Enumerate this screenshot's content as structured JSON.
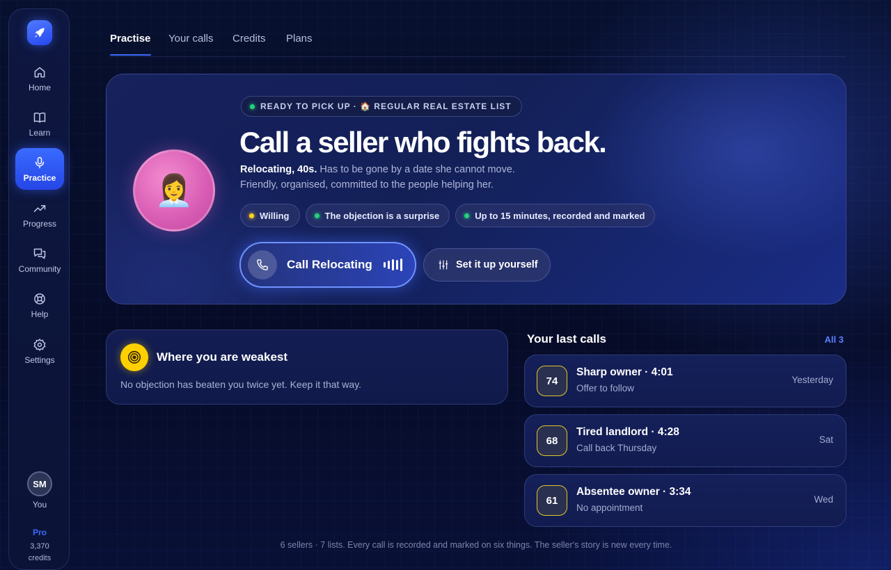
{
  "sidebar": {
    "items": [
      {
        "label": "Home",
        "icon": "home-icon"
      },
      {
        "label": "Learn",
        "icon": "book-icon"
      },
      {
        "label": "Practice",
        "icon": "microphone-icon",
        "active": true
      },
      {
        "label": "Progress",
        "icon": "trending-up-icon"
      },
      {
        "label": "Community",
        "icon": "chat-bubbles-icon"
      },
      {
        "label": "Help",
        "icon": "lifebuoy-icon"
      },
      {
        "label": "Settings",
        "icon": "gear-icon"
      }
    ],
    "user": {
      "initials": "SM",
      "label": "You"
    },
    "plan": "Pro",
    "credits": "3,370",
    "credits_label": "credits"
  },
  "tabs": [
    "Practise",
    "Your calls",
    "Credits",
    "Plans"
  ],
  "hero": {
    "status": "READY TO PICK UP · 🏠 REGULAR REAL ESTATE LIST",
    "title": "Call a seller who fights back.",
    "persona": "Relocating, 40s.",
    "persona_desc": " Has to be gone by a date she cannot move.",
    "persona_desc2": "Friendly, organised, committed to the people helping her.",
    "avatar_emoji": "👩‍💼",
    "chips": [
      {
        "label": "Willing",
        "color": "#ffd21e"
      },
      {
        "label": "The objection is a surprise",
        "color": "#22d37a"
      },
      {
        "label": "Up to 15 minutes, recorded and marked",
        "color": "#22d37a"
      }
    ],
    "call_button": "Call Relocating",
    "setup_button": "Set it up yourself"
  },
  "weakest": {
    "title": "Where you are weakest",
    "text": "No objection has beaten you twice yet. Keep it that way."
  },
  "last_calls": {
    "title": "Your last calls",
    "all_link": "All 3",
    "items": [
      {
        "score": "74",
        "name": "Sharp owner · 4:01",
        "outcome": "Offer to follow",
        "when": "Yesterday"
      },
      {
        "score": "68",
        "name": "Tired landlord · 4:28",
        "outcome": "Call back Thursday",
        "when": "Sat"
      },
      {
        "score": "61",
        "name": "Absentee owner · 3:34",
        "outcome": "No appointment",
        "when": "Wed"
      }
    ]
  },
  "footer": "6 sellers · 7 lists. Every call is recorded and marked on six things. The seller's story is new every time.",
  "colors": {
    "accent": "#3c6bff",
    "background": "#050b26",
    "score_border": "#e3c62a"
  }
}
